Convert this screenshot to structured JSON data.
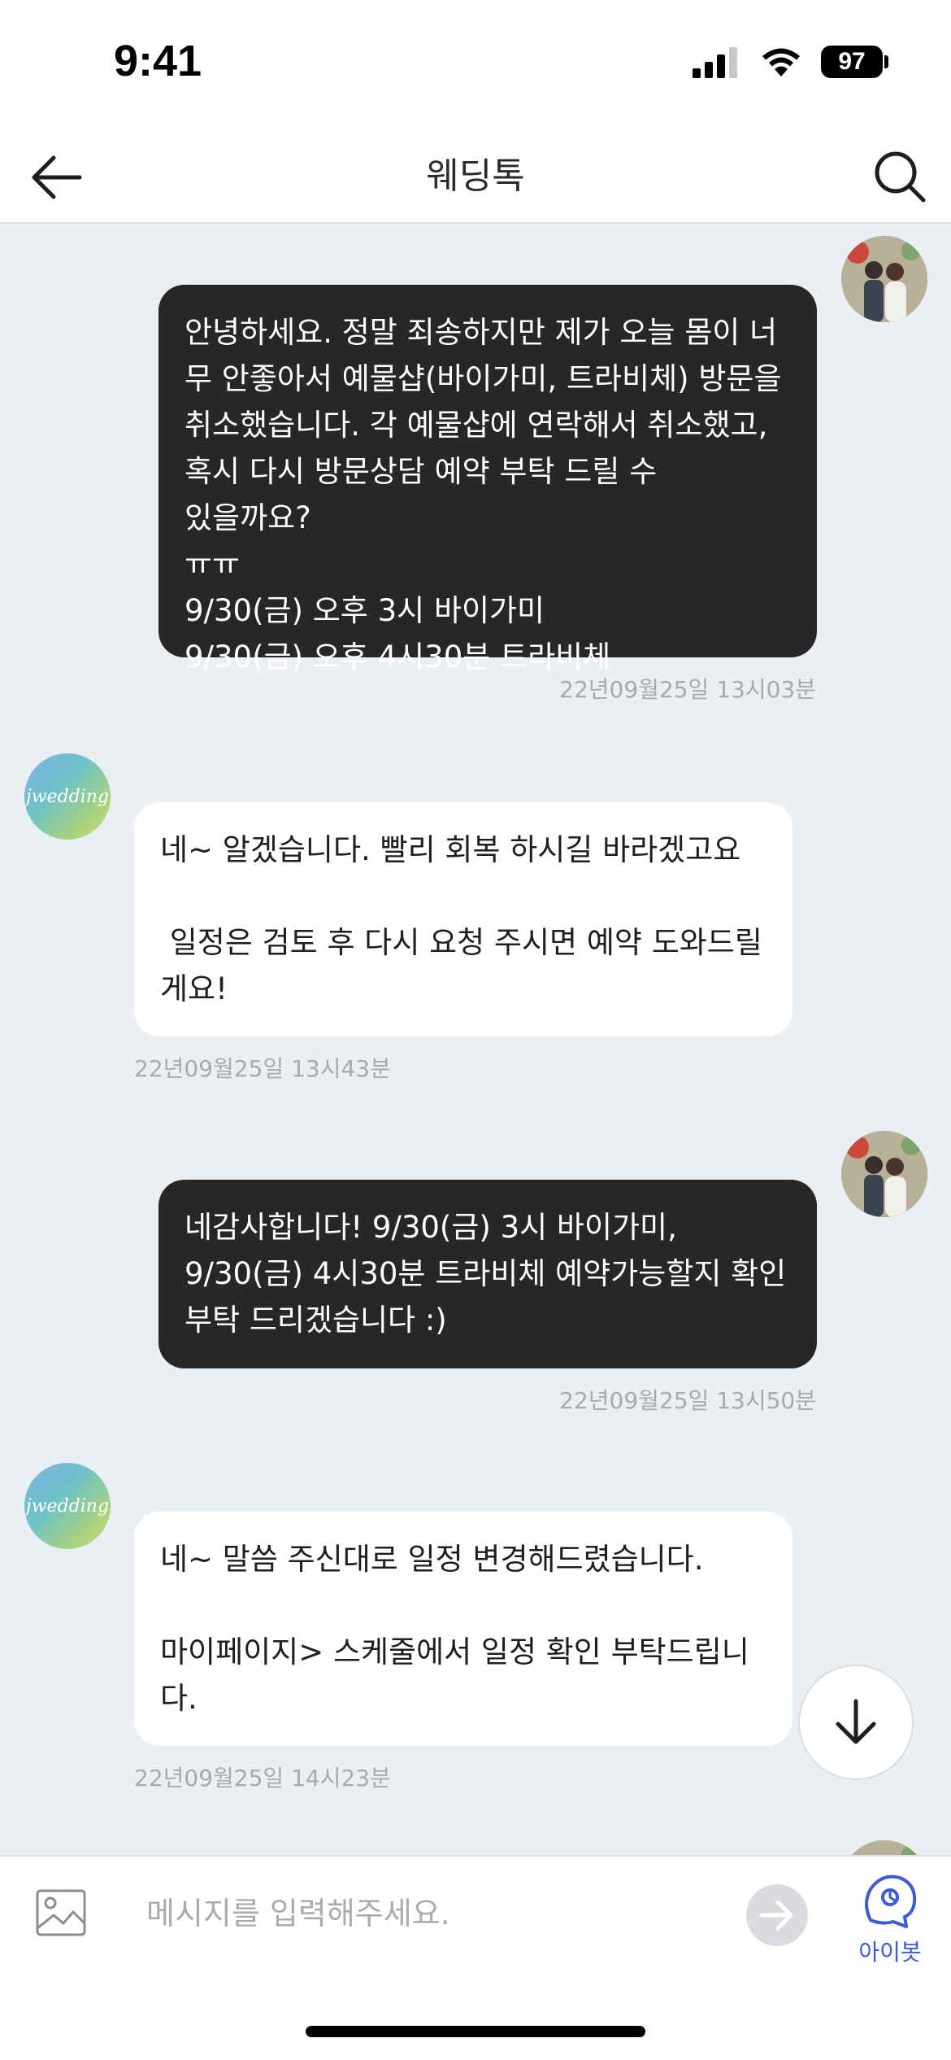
{
  "status": {
    "time": "9:41",
    "battery": "97"
  },
  "header": {
    "title": "웨딩톡"
  },
  "messages": [
    {
      "sender": "user",
      "text": "안녕하세요. 정말 죄송하지만 제가 오늘 몸이 너\n무 안좋아서 예물샵(바이가미, 트라비체) 방문을\n취소했습니다. 각 예물샵에 연락해서 취소했고,\n혹시 다시 방문상담 예약 부탁 드릴 수 있을까요?\nㅠㅠ\n9/30(금) 오후 3시 바이가미\n9/30(금) 오후 4시30분 트라비체",
      "timestamp": "22년09월25일 13시03분"
    },
    {
      "sender": "brand",
      "text": "네~ 알겠습니다. 빨리 회복 하시길 바라겠고요\n\n 일정은 검토 후 다시 요청 주시면 예약 도와드릴\n게요!",
      "timestamp": "22년09월25일 13시43분"
    },
    {
      "sender": "user",
      "text": "네감사합니다! 9/30(금) 3시 바이가미,\n9/30(금) 4시30분 트라비체 예약가능할지 확인\n부탁 드리겠습니다 :)",
      "timestamp": "22년09월25일 13시50분"
    },
    {
      "sender": "brand",
      "text": "네~ 말씀 주신대로 일정 변경해드렸습니다.\n\n마이페이지> 스케줄에서 일정 확인 부탁드립니\n다.",
      "timestamp": "22년09월25일 14시23분"
    }
  ],
  "brand_avatar_text": "jwedding",
  "input": {
    "placeholder": "메시지를 입력해주세요."
  },
  "bot": {
    "label": "아이봇"
  }
}
